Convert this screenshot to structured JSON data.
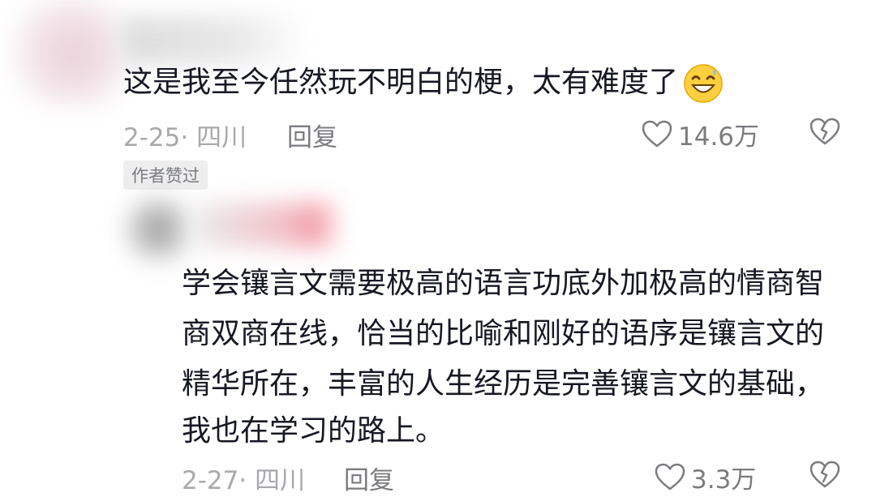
{
  "comments": [
    {
      "text": "这是我至今任然玩不明白的梗，太有难度了",
      "emoji_icon": "grinning-sweat-face-icon",
      "date_location": "2-25· 四川",
      "reply_label": "回复",
      "likes": "14.6万",
      "author_liked_badge": "作者赞过"
    },
    {
      "lines": [
        "学会镶言文需要极高的语言功底外加极高的情商智",
        "商双商在线，恰当的比喻和刚好的语序是镶言文的",
        "精华所在，丰富的人生经历是完善镶言文的基础，",
        "我也在学习的路上。"
      ],
      "date_location": "2-27· 四川",
      "reply_label": "回复",
      "likes": "3.3万"
    }
  ],
  "colors": {
    "text_primary": "#161823",
    "text_secondary": "#a8a9ad",
    "action_gray": "#7b7c80",
    "badge_bg": "#eeeeef"
  }
}
